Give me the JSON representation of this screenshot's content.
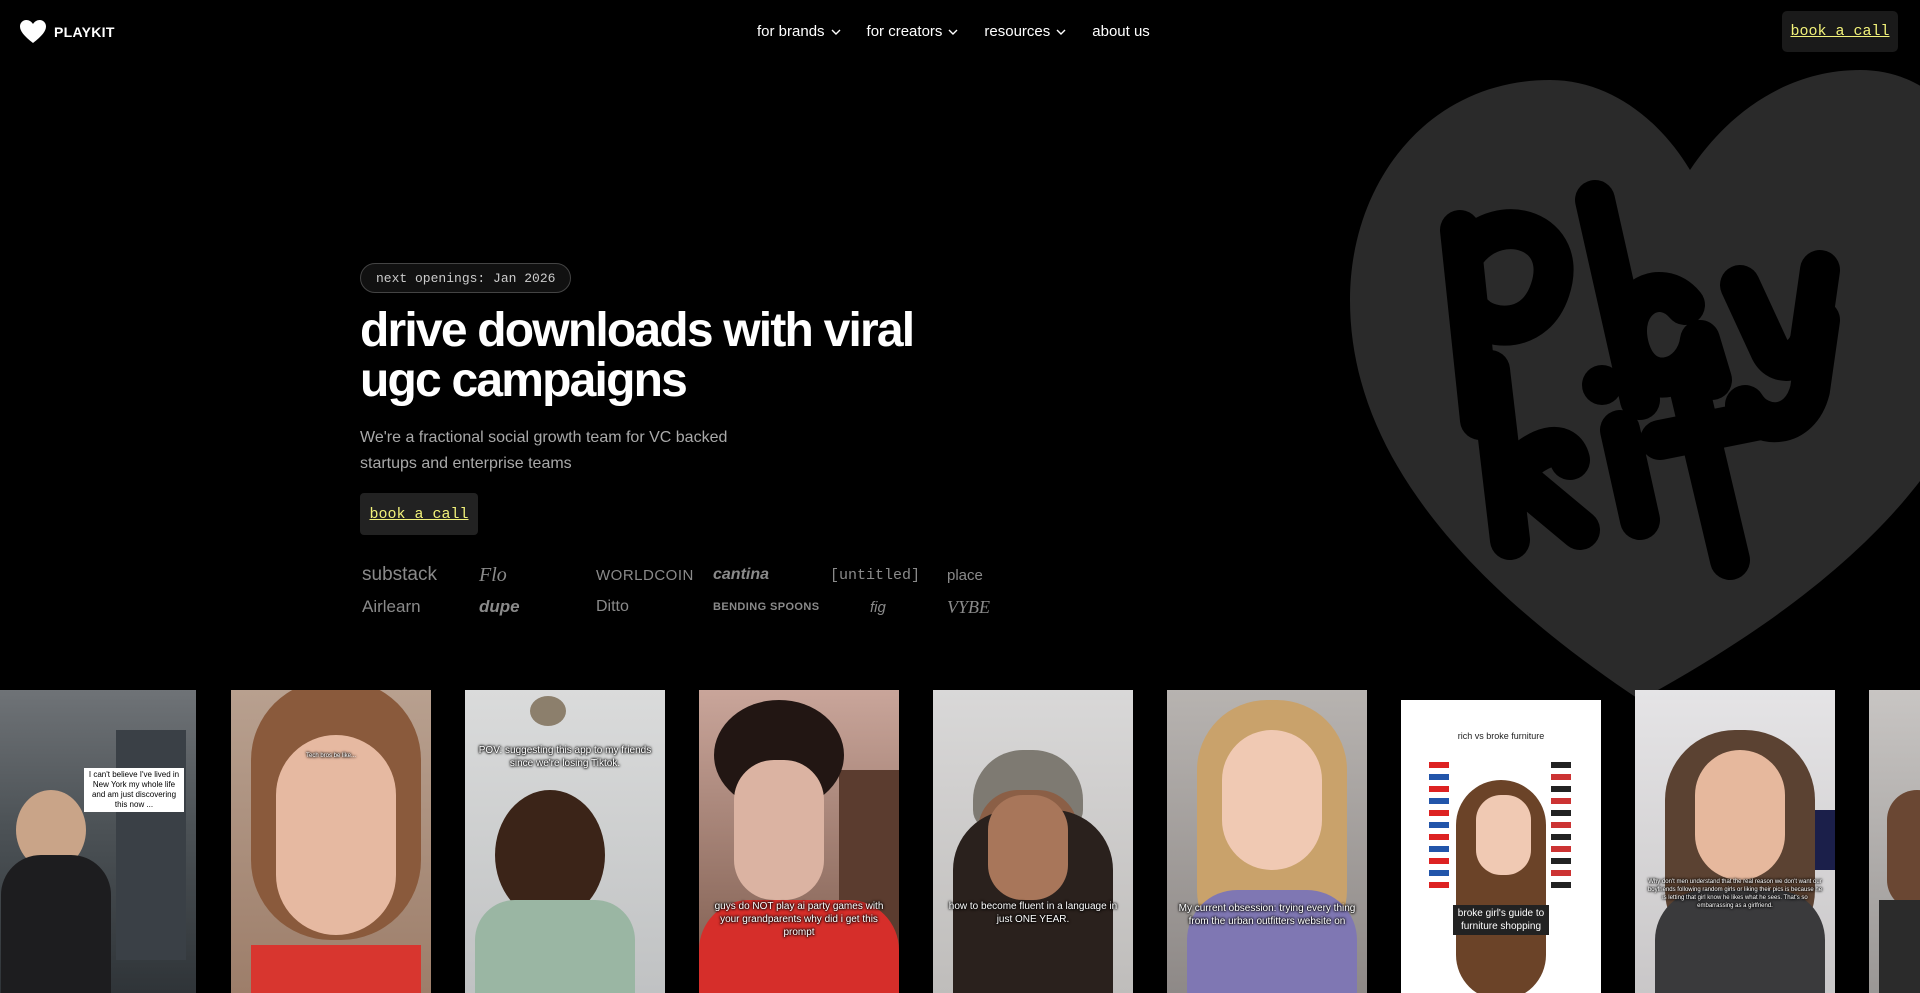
{
  "brand": {
    "name": "PLAYKIT"
  },
  "nav": {
    "items": [
      {
        "label": "for brands",
        "has_dropdown": true
      },
      {
        "label": "for creators",
        "has_dropdown": true
      },
      {
        "label": "resources",
        "has_dropdown": true
      },
      {
        "label": "about us",
        "has_dropdown": false
      }
    ],
    "cta_label": "book a call"
  },
  "hero": {
    "pill": "next openings: Jan 2026",
    "title": "drive downloads with viral ugc campaigns",
    "subtitle": "We're a fractional social growth team for VC backed startups and enterprise teams",
    "cta_label": "book a call"
  },
  "brands": [
    "substack",
    "Flo",
    "WORLDCOIN",
    "cantina",
    "[untitled]",
    "place",
    "Airlearn",
    "dupe",
    "Ditto",
    "BENDING SPOONS",
    "fig",
    "VYBE"
  ],
  "videos": [
    {
      "caption": "I can't believe I've lived in New York my whole life and am just discovering this now ..."
    },
    {
      "caption": "Tech bros be like..."
    },
    {
      "caption": "POV: suggesting this app to my friends since we're losing Tiktok."
    },
    {
      "caption": "guys do NOT play ai party games with your grandparents why did i get this prompt"
    },
    {
      "caption": "how to become fluent in a language in just ONE YEAR."
    },
    {
      "caption": "My current obsession: trying every thing from the urban outfitters website on"
    },
    {
      "caption_top": "rich vs broke furniture",
      "caption": "broke girl's guide to furniture shopping"
    },
    {
      "caption": "Why don't men understand that the real reason we don't want our boyfriends following random girls or liking their pics is because he is letting that girl know he likes what he sees. That's so embarrassing as a girlfriend."
    },
    {
      "caption": ""
    }
  ],
  "colors": {
    "background": "#000000",
    "cta_text": "#f2f27a",
    "heart": "#2a2a2a",
    "muted_text": "#a9a9a9"
  }
}
